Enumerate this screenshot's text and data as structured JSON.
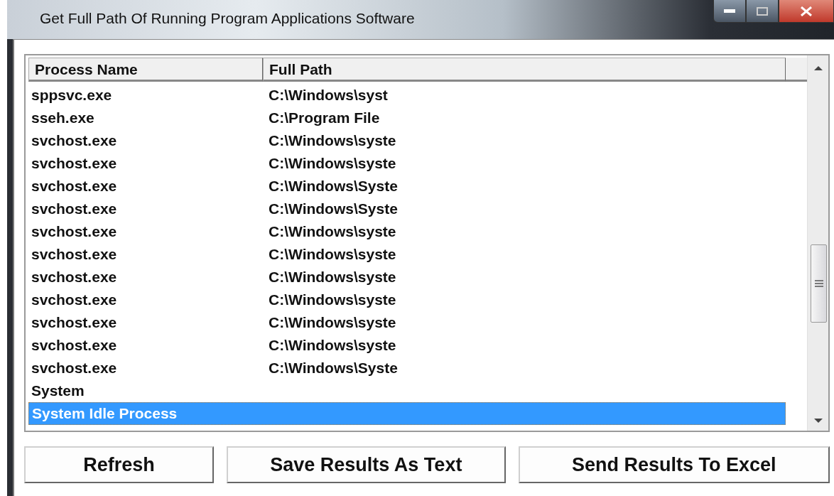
{
  "window": {
    "title": "Get Full Path Of Running Program Applications Software"
  },
  "table": {
    "columns": [
      "Process Name",
      "Full Path"
    ],
    "rows": [
      {
        "process_name": "sppsvc.exe",
        "full_path": "C:\\Windows\\syst",
        "selected": false
      },
      {
        "process_name": "sseh.exe",
        "full_path": "C:\\Program File",
        "selected": false
      },
      {
        "process_name": "svchost.exe",
        "full_path": "C:\\Windows\\syste",
        "selected": false
      },
      {
        "process_name": "svchost.exe",
        "full_path": "C:\\Windows\\syste",
        "selected": false
      },
      {
        "process_name": "svchost.exe",
        "full_path": "C:\\Windows\\Syste",
        "selected": false
      },
      {
        "process_name": "svchost.exe",
        "full_path": "C:\\Windows\\Syste",
        "selected": false
      },
      {
        "process_name": "svchost.exe",
        "full_path": "C:\\Windows\\syste",
        "selected": false
      },
      {
        "process_name": "svchost.exe",
        "full_path": "C:\\Windows\\syste",
        "selected": false
      },
      {
        "process_name": "svchost.exe",
        "full_path": "C:\\Windows\\syste",
        "selected": false
      },
      {
        "process_name": "svchost.exe",
        "full_path": "C:\\Windows\\syste",
        "selected": false
      },
      {
        "process_name": "svchost.exe",
        "full_path": "C:\\Windows\\syste",
        "selected": false
      },
      {
        "process_name": "svchost.exe",
        "full_path": "C:\\Windows\\syste",
        "selected": false
      },
      {
        "process_name": "svchost.exe",
        "full_path": "C:\\Windows\\Syste",
        "selected": false
      },
      {
        "process_name": "System",
        "selected": false
      },
      {
        "process_name": "System Idle Process",
        "selected": true
      }
    ]
  },
  "buttons": [
    "Refresh",
    "Save Results As Text",
    "Send Results To Excel"
  ]
}
